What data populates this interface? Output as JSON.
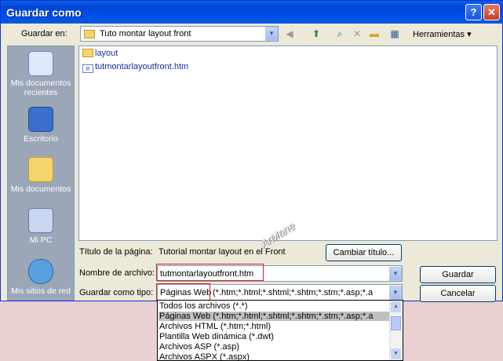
{
  "window": {
    "title": "Guardar como"
  },
  "title_buttons": {
    "help": "?",
    "close": "✕"
  },
  "toolbar": {
    "save_in_label": "Guardar en:",
    "location": "Tuto montar layout front",
    "tools_label": "Herramientas"
  },
  "places": [
    {
      "label": "Mis documentos recientes",
      "icon": "recent-documents-icon"
    },
    {
      "label": "Escritorio",
      "icon": "desktop-icon"
    },
    {
      "label": "Mis documentos",
      "icon": "my-documents-icon"
    },
    {
      "label": "Mi PC",
      "icon": "my-computer-icon"
    },
    {
      "label": "Mis sitios de red",
      "icon": "network-places-icon"
    }
  ],
  "files": [
    {
      "name": "layout",
      "icon": "folder-icon"
    },
    {
      "name": "tutmontarlayoutfront.htm",
      "icon": "ie-document-icon"
    }
  ],
  "page_title": {
    "label": "Título de la página:",
    "value": "Tutorial montar layout en el Front",
    "change_button": "Cambiar título..."
  },
  "filename": {
    "label": "Nombre de archivo:",
    "value": "tutmontarlayoutfront.htm"
  },
  "filetype": {
    "label": "Guardar como tipo:",
    "value_head": "Páginas Web",
    "value_tail": "(*.htm;*.html;*.shtml;*.shtm;*.stm;*.asp;*.a",
    "options": [
      "Todos los archivos (*.*)",
      "Páginas Web (*.htm;*.html;*.shtml;*.shtm;*.stm;*.asp;*.a",
      "Archivos HTML (*.htm;*.html)",
      "Plantilla Web dinámica (*.dwt)",
      "Archivos ASP (*.asp)",
      "Archivos ASPX (*.aspx)"
    ],
    "selected_index": 1
  },
  "buttons": {
    "save": "Guardar",
    "cancel": "Cancelar"
  },
  "watermark": "ArMane",
  "colors": {
    "titlebar": "#0054e3",
    "highlight_box": "#e02020",
    "dialog_bg": "#ece9d8"
  }
}
